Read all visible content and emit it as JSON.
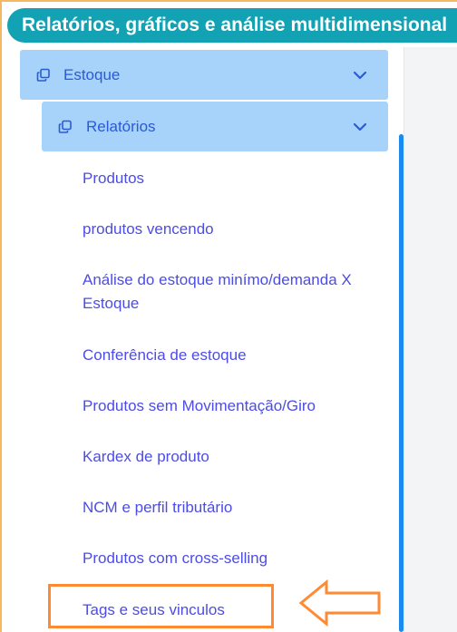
{
  "header": {
    "title": "Relatórios, gráficos e análise multidimensional"
  },
  "menu": {
    "estoque": {
      "label": "Estoque"
    },
    "relatorios": {
      "label": "Relatórios"
    },
    "items": [
      "Produtos",
      "produtos vencendo",
      "Análise do estoque minímo/demanda X Estoque",
      "Conferência de estoque",
      "Produtos sem Movimentação/Giro",
      "Kardex de produto",
      "NCM e perfil tributário",
      "Produtos com cross-selling",
      "Tags e seus vinculos"
    ]
  },
  "colors": {
    "header_bg": "#13a2b4",
    "menu_row_bg": "#a7d3fa",
    "menu_text": "#2a5ad6",
    "item_text": "#4c4ce6",
    "highlight": "#ff8a33",
    "scrollbar": "#1a8af0"
  },
  "annotation": {
    "highlighted_item": "Tags e seus vinculos",
    "marker": "arrow-left-outline"
  }
}
